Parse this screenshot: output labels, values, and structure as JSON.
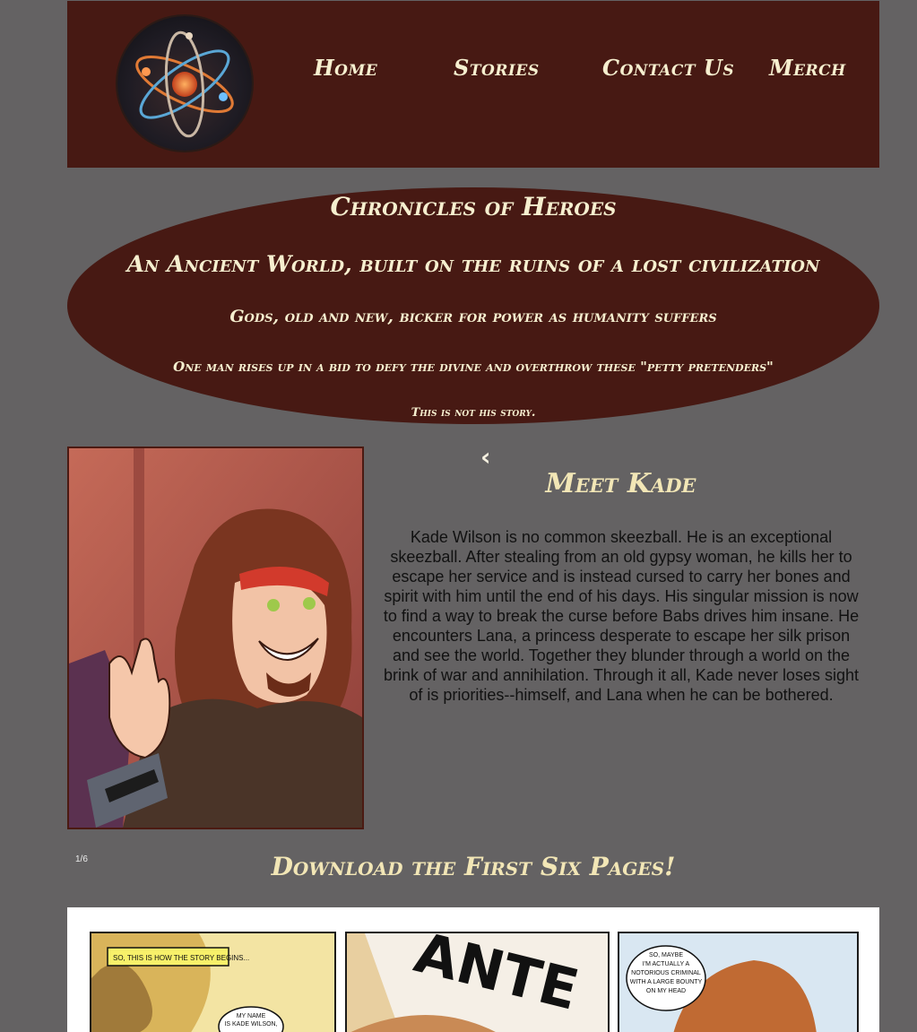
{
  "nav": {
    "items": [
      "Home",
      "Stories",
      "Contact Us",
      "Merch"
    ]
  },
  "hero": {
    "title": "Chronicles of Heroes",
    "line1": "An Ancient World, built on the ruins of a lost civilization",
    "line2": "Gods, old and new, bicker for power as humanity suffers",
    "line3": "One man rises up in a bid to defy the divine and overthrow these \"petty pretenders\"",
    "line4": "This is not his story."
  },
  "carousel": {
    "prev_label": "‹",
    "counter": "1/6",
    "character_name": "Meet Kade",
    "description": "Kade Wilson is no common skeezball. He is an exceptional skeezball. After stealing from an old gypsy woman, he kills her to escape her service and is instead cursed to carry her bones and spirit with him until the end of his days. His singular mission is now to find a way to break the curse before Babs drives him insane. He encounters Lana, a princess desperate to escape her silk prison and see the world. Together they blunder through a world on the brink of war and annihilation. Through it all, Kade never loses sight of is priorities--himself, and Lana when he can be bothered."
  },
  "download": {
    "title": "Download the First Six Pages!",
    "page1": {
      "caption": "SO, THIS IS HOW THE STORY BEGINS...",
      "bubble": "MY NAME IS KADE WILSON, AND I'M THE HERO"
    },
    "page2": {
      "poster_text": "ANTE"
    },
    "page3": {
      "bubble": "SO, MAYBE I'M ACTUALLY A NOTORIOUS CRIMINAL WITH A LARGE BOUNTY ON MY HEAD"
    }
  },
  "colors": {
    "background": "#646263",
    "header_bg": "#471913",
    "accent_text": "#f6efcf"
  }
}
